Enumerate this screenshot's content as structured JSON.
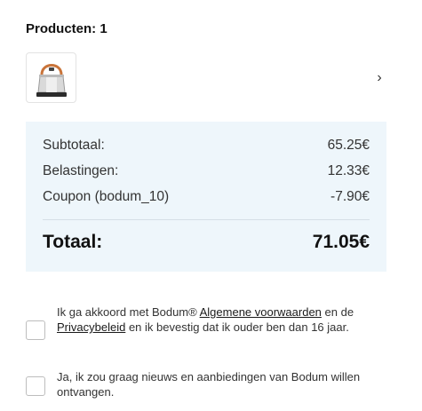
{
  "products": {
    "title": "Producten: 1",
    "item_image_icon": "kettle-image",
    "chevron": "›"
  },
  "summary": {
    "subtotal_label": "Subtotaal:",
    "subtotal_value": "65.25€",
    "tax_label": "Belastingen:",
    "tax_value": "12.33€",
    "coupon_label": "Coupon (bodum_10)",
    "coupon_value": "-7.90€",
    "total_label": "Totaal:",
    "total_value": "71.05€"
  },
  "consent": {
    "terms_text_1": "Ik ga akkoord met Bodum® ",
    "terms_link_1": "Algemene voorwaarden",
    "terms_text_2": " en de ",
    "terms_link_2": "Privacybeleid",
    "terms_text_3": " en ik bevestig dat ik ouder ben dan 16 jaar.",
    "newsletter_text": "Ja, ik zou graag nieuws en aanbiedingen van Bodum willen ontvangen."
  },
  "colors": {
    "summary_background": "#eef6fb",
    "text": "#1a1a1a"
  }
}
